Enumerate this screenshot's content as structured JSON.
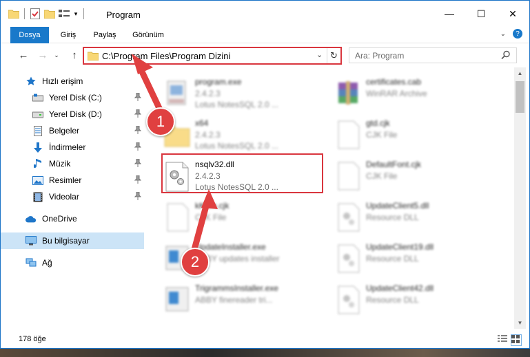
{
  "window": {
    "title": "Program",
    "minimize": "—",
    "maximize": "☐",
    "close": "✕"
  },
  "ribbon": {
    "tabs": [
      {
        "label": "Dosya"
      },
      {
        "label": "Giriş"
      },
      {
        "label": "Paylaş"
      },
      {
        "label": "Görünüm"
      }
    ],
    "help": "?"
  },
  "address": {
    "path": "C:\\Program Files\\Program Dizini",
    "search_placeholder": "Ara: Program"
  },
  "sidebar": {
    "items": [
      {
        "label": "Hızlı erişim",
        "icon": "star-icon"
      },
      {
        "label": "Yerel Disk (C:)",
        "icon": "drive-icon"
      },
      {
        "label": "Yerel Disk (D:)",
        "icon": "drive-icon"
      },
      {
        "label": "Belgeler",
        "icon": "documents-icon"
      },
      {
        "label": "İndirmeler",
        "icon": "download-icon"
      },
      {
        "label": "Müzik",
        "icon": "music-icon"
      },
      {
        "label": "Resimler",
        "icon": "pictures-icon"
      },
      {
        "label": "Videolar",
        "icon": "videos-icon"
      },
      {
        "label": "OneDrive",
        "icon": "cloud-icon"
      },
      {
        "label": "Bu bilgisayar",
        "icon": "computer-icon"
      },
      {
        "label": "Ağ",
        "icon": "network-icon"
      }
    ]
  },
  "files": [
    {
      "name": "program.exe",
      "l2": "2.4.2.3",
      "l3": "Lotus NotesSQL 2.0 ..."
    },
    {
      "name": "x64",
      "l2": "2.4.2.3",
      "l3": "Lotus NotesSQL 2.0 ..."
    },
    {
      "name": "nsqlv32.dll",
      "l2": "2.4.2.3",
      "l3": "Lotus NotesSQL 2.0 ..."
    },
    {
      "name": "kKorn.cjk",
      "l2": "CJK File",
      "l3": ""
    },
    {
      "name": "UpdateInstaller.exe",
      "l2": "ABBY updates installer",
      "l3": ""
    },
    {
      "name": "TrigrammsInstaller.exe",
      "l2": "ABBY finereader tri...",
      "l3": ""
    },
    {
      "name": "certificates.cab",
      "l2": "WinRAR Archive",
      "l3": ""
    },
    {
      "name": "gtd.cjk",
      "l2": "CJK File",
      "l3": ""
    },
    {
      "name": "DefaultFont.cjk",
      "l2": "CJK File",
      "l3": ""
    },
    {
      "name": "UpdateClient5.dll",
      "l2": "Resource DLL",
      "l3": ""
    },
    {
      "name": "UpdateClient19.dll",
      "l2": "Resource DLL",
      "l3": ""
    },
    {
      "name": "UpdateClient42.dll",
      "l2": "Resource DLL",
      "l3": ""
    }
  ],
  "status": {
    "count": "178 öğe"
  },
  "annotations": {
    "step1": "1",
    "step2": "2"
  },
  "colors": {
    "accent": "#1979ca",
    "highlight": "#d9363e",
    "badge": "#e04040",
    "selected": "#cce4f7"
  }
}
